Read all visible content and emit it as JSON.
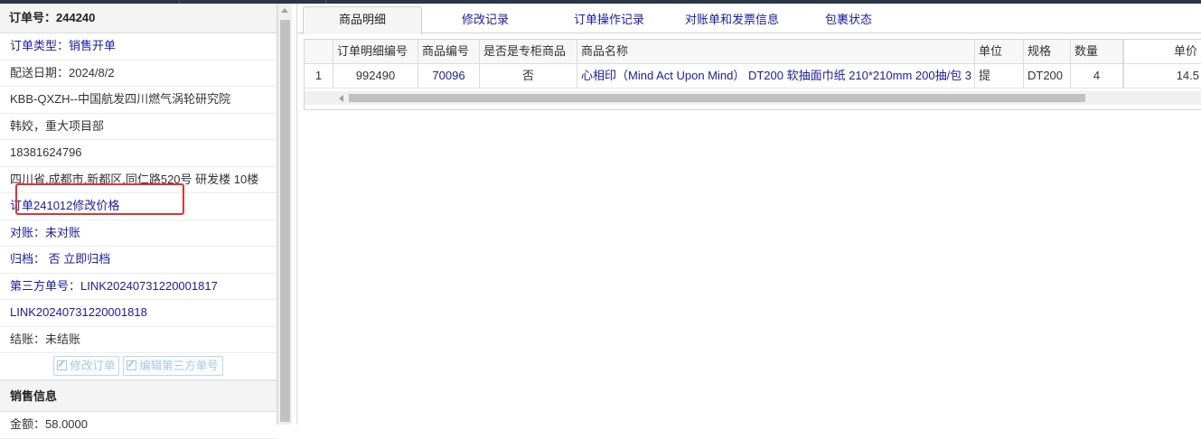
{
  "order": {
    "title": "订单号：244240",
    "type": "订单类型：销售开单",
    "delivery_date": "配送日期：2024/8/2",
    "customer": "KBB-QXZH--中国航发四川燃气涡轮研究院",
    "contact": "韩姣，重大项目部",
    "phone": "18381624796",
    "address": "四川省.成都市.新都区.同仁路520号 研发楼 10楼",
    "note": "订单241012修改价格",
    "reconcile": "对账：未对账",
    "archive": "归档： 否 立即归档",
    "third_party_1": "第三方单号：LINK20240731220001817",
    "third_party_2": "LINK20240731220001818",
    "settlement": "结账：未结账",
    "edit_order_label": "修改订单",
    "edit_third_party_label": "编辑第三方单号"
  },
  "sales": {
    "section_title": "销售信息",
    "amount": "金额：58.0000"
  },
  "tabs": [
    {
      "label": "商品明细",
      "active": true
    },
    {
      "label": "修改记录"
    },
    {
      "label": "订单操作记录"
    },
    {
      "label": "对账单和发票信息"
    },
    {
      "label": "包裹状态"
    }
  ],
  "table": {
    "columns": [
      "",
      "订单明细编号",
      "商品编号",
      "是否是专柜商品",
      "商品名称",
      "单位",
      "规格",
      "数量",
      "单价"
    ],
    "rows": [
      [
        "1",
        "992490",
        "70096",
        "否",
        "心相印（Mind Act Upon Mind） DT200 软抽面巾纸 210*210mm 200抽/包 3",
        "提",
        "DT200",
        "4",
        "14.5"
      ]
    ]
  },
  "colors": {
    "link": "#1a1aa6",
    "highlight": "#e53030",
    "topbar": "#2a3546"
  },
  "icons": [
    "edit-icon"
  ]
}
